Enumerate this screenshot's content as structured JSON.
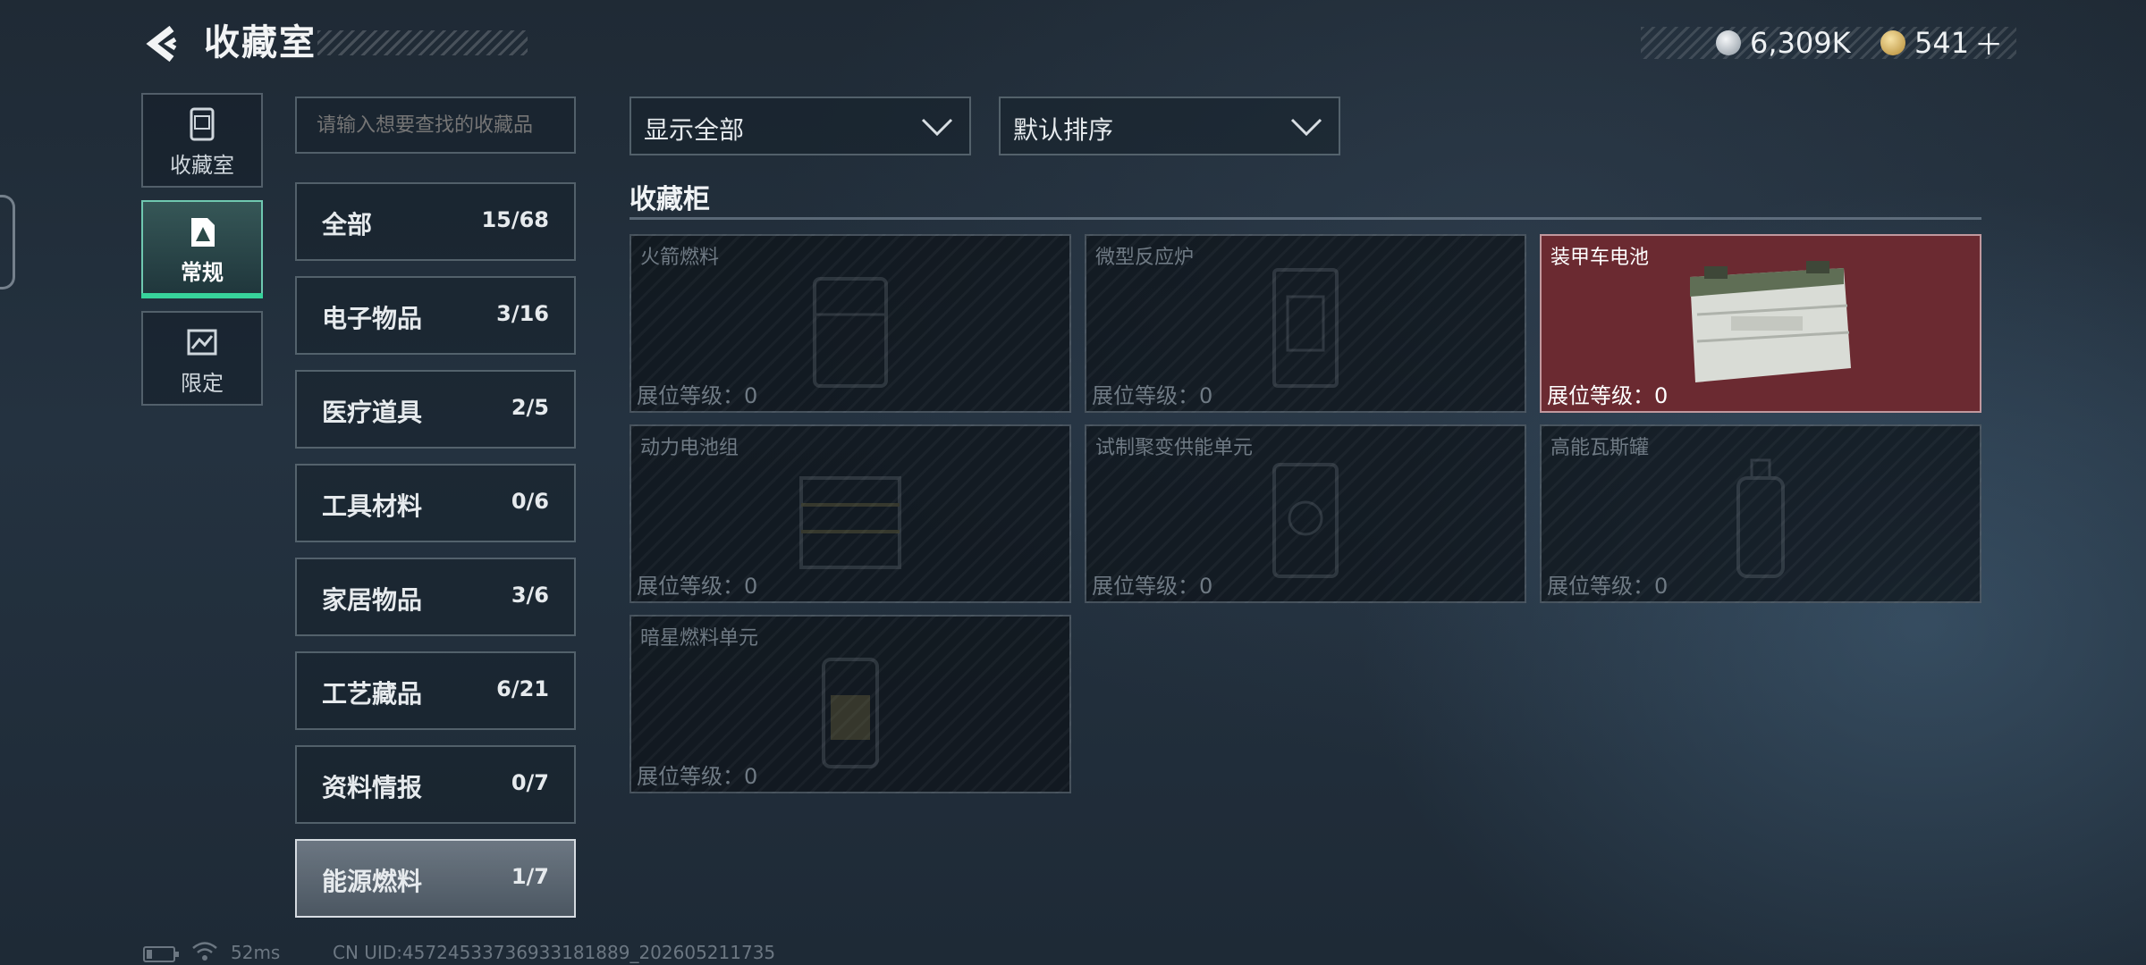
{
  "header": {
    "title": "收藏室",
    "currency1": "6,309K",
    "currency2": "541",
    "add": "＋"
  },
  "side_tabs": [
    {
      "label": "收藏室",
      "icon": "showcase-icon"
    },
    {
      "label": "常规",
      "icon": "regular-collection-icon",
      "active": true
    },
    {
      "label": "限定",
      "icon": "limited-collection-icon"
    }
  ],
  "search": {
    "placeholder": "请输入想要查找的收藏品"
  },
  "categories": [
    {
      "name": "全部",
      "count": "15/68"
    },
    {
      "name": "电子物品",
      "count": "3/16"
    },
    {
      "name": "医疗道具",
      "count": "2/5"
    },
    {
      "name": "工具材料",
      "count": "0/6"
    },
    {
      "name": "家居物品",
      "count": "3/6"
    },
    {
      "name": "工艺藏品",
      "count": "6/21"
    },
    {
      "name": "资料情报",
      "count": "0/7"
    },
    {
      "name": "能源燃料",
      "count": "1/7",
      "active": true
    }
  ],
  "filters": {
    "show": "显示全部",
    "sort": "默认排序"
  },
  "section": {
    "title": "收藏柜"
  },
  "items": [
    {
      "name": "火箭燃料",
      "level": "展位等级：0",
      "owned": false
    },
    {
      "name": "微型反应炉",
      "level": "展位等级：0",
      "owned": false
    },
    {
      "name": "装甲车电池",
      "level": "展位等级：0",
      "owned": true
    },
    {
      "name": "动力电池组",
      "level": "展位等级：0",
      "owned": false
    },
    {
      "name": "试制聚变供能单元",
      "level": "展位等级：0",
      "owned": false
    },
    {
      "name": "高能瓦斯罐",
      "level": "展位等级：0",
      "owned": false
    },
    {
      "name": "暗星燃料单元",
      "level": "展位等级：0",
      "owned": false
    }
  ],
  "footer": {
    "ping": "52ms",
    "uid": "CN UID:4572453373693318​1889_202605211735"
  },
  "colors": {
    "accent": "#37d39b",
    "owned_card": "#6b2a31"
  }
}
